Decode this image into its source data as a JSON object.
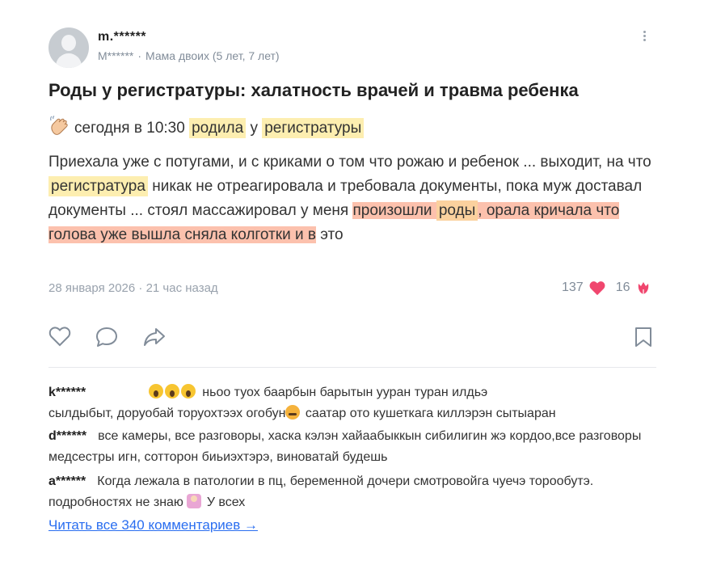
{
  "author": {
    "username": "m.******",
    "display_name": "M******",
    "description": "Мама двоих (5 лет, 7 лет)"
  },
  "post": {
    "title": "Роды у регистратуры: халатность врачей и травма ребенка",
    "meta_time": "сегодня в 10:30",
    "meta_word1": "родила",
    "meta_word2": "у",
    "meta_word3": "регистратуры",
    "excerpt": {
      "p1": "Приехала уже с потугами, и с криками о том что рожаю и ребенок ... выходит, на что ",
      "hl1": "регистратура",
      "p2": " никак не отреагировала и требовала документы, пока муж доставал документы ... стоял массажировал у меня ",
      "hl2a": "произошли ",
      "hl2b": "роды",
      "hl2c": ", орала кричала что голова уже вышла сняла колготки и в",
      "p3": " это"
    },
    "date": "28 января 2026 · 21 час назад",
    "likes": "137",
    "reactions": "16"
  },
  "icons": {
    "like": "heart-outline-icon",
    "comment": "comment-icon",
    "share": "share-icon",
    "bookmark": "bookmark-icon",
    "menu": "more-vertical-icon",
    "wave": "waving-hand-icon",
    "heart": "heart-filled-icon",
    "tulip": "tulip-icon"
  },
  "colors": {
    "heart": "#f0466e",
    "link": "#2a6ef0",
    "highlight_yellow": "#fdeeb0",
    "highlight_orange": "#fbd19e",
    "highlight_salmon": "#fcc1ad"
  },
  "comments": [
    {
      "user": "k******",
      "text_line1": "ньоо туох баарбын барытын ууран туран илдьэ",
      "text_line2a": "сылдыбыт, доруобай торуохтээх огобун",
      "text_line2b": " саатар ото кушеткага киллэрэн сытыаран"
    },
    {
      "user": "d******",
      "text": "все камеры, все разговоры, хаска кэлэн хайаабыккын сибилигин жэ кордоо,все разговоры медсестры игн, сотторон биьиэхтэрэ, виноватай будешь"
    },
    {
      "user": "a******",
      "text_a": "Когда лежала в патологии в пц, беременной дочери смотровойга чуечэ торообутэ. подробностях не знаю ",
      "text_b": " У всех"
    }
  ],
  "read_all": "Читать все 340 комментариев →"
}
